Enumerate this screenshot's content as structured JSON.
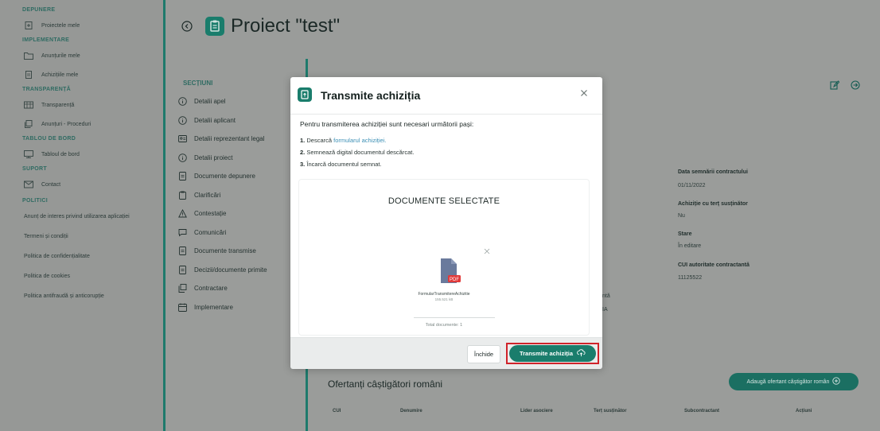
{
  "sidebar": {
    "sections": [
      {
        "title": "DEPUNERE",
        "items": [
          {
            "label": "Proiectele mele",
            "icon": "file-plus-icon"
          }
        ]
      },
      {
        "title": "IMPLEMENTARE",
        "items": [
          {
            "label": "Anunțurile mele",
            "icon": "folder-icon"
          },
          {
            "label": "Achizițiile mele",
            "icon": "document-icon"
          }
        ]
      },
      {
        "title": "TRANSPARENȚĂ",
        "items": [
          {
            "label": "Transparență",
            "icon": "table-icon"
          },
          {
            "label": "Anunțuri - Proceduri",
            "icon": "copy-icon"
          }
        ]
      },
      {
        "title": "TABLOU DE BORD",
        "items": [
          {
            "label": "Tabloul de bord",
            "icon": "dashboard-icon"
          }
        ]
      },
      {
        "title": "SUPORT",
        "items": [
          {
            "label": "Contact",
            "icon": "mail-icon"
          }
        ]
      }
    ],
    "politici_title": "POLITICI",
    "politici_links": [
      "Anunț de interes privind utilizarea aplicației",
      "Termeni și condiții",
      "Politica de confidențialitate",
      "Politica de cookies",
      "Politica antifraudă și anticorupție"
    ]
  },
  "header": {
    "title": "Proiect \"test\""
  },
  "sections": {
    "title": "SECȚIUNI",
    "items": [
      {
        "label": "Detalii apel",
        "icon": "info-icon"
      },
      {
        "label": "Detalii aplicant",
        "icon": "info-icon"
      },
      {
        "label": "Detalii reprezentant legal",
        "icon": "id-card-icon"
      },
      {
        "label": "Detalii proiect",
        "icon": "info-icon"
      },
      {
        "label": "Documente depunere",
        "icon": "document-icon"
      },
      {
        "label": "Clarificări",
        "icon": "clipboard-icon"
      },
      {
        "label": "Contestație",
        "icon": "warning-icon"
      },
      {
        "label": "Comunicări",
        "icon": "chat-icon"
      },
      {
        "label": "Documente transmise",
        "icon": "document-icon"
      },
      {
        "label": "Decizii/documente primite",
        "icon": "document-icon"
      },
      {
        "label": "Contractare",
        "icon": "copy-icon"
      },
      {
        "label": "Implementare",
        "icon": "calendar-icon"
      }
    ]
  },
  "details": {
    "data_semnarii_label": "Data semnării contractului",
    "data_semnarii_value": "01/11/2022",
    "tert_label": "Achiziție cu terț susținător",
    "tert_value": "Nu",
    "stare_label": "Stare",
    "stare_value": "În editare",
    "cui_label": "CUI autoritate contractantă",
    "cui_value": "11125522",
    "fragment_1": "ntă",
    "fragment_2": "IA"
  },
  "ofertanti": {
    "title": "Ofertanți câștigători români",
    "add_button": "Adaugă ofertant câștigător român",
    "columns": [
      "CUI",
      "Denumire",
      "Lider asociere",
      "Terț susținător",
      "Subcontractant",
      "Acțiuni"
    ]
  },
  "modal": {
    "title": "Transmite achiziția",
    "intro": "Pentru transmiterea achiziției sunt necesari următorii pași:",
    "step1_num": "1.",
    "step1_prefix": "Descarcă",
    "step1_link": "formularul achiziției.",
    "step2_num": "2.",
    "step2_text": "Semnează digital documentul descărcat.",
    "step3_num": "3.",
    "step3_text": "Încarcă documentul semnat.",
    "docs_title": "DOCUMENTE SELECTATE",
    "file_name": "FormularTransmitereAchizitie",
    "file_size": "155.521 kB",
    "total": "Total documente: 1",
    "close_button": "Închide",
    "submit_button": "Transmite achiziția"
  },
  "colors": {
    "accent": "#1a7d6c",
    "highlight": "#d0232a",
    "link": "#3b8fb5"
  }
}
